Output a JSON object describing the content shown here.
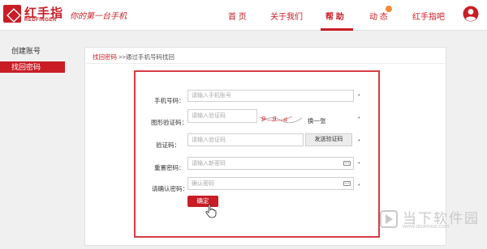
{
  "header": {
    "logo_cn": "红手指",
    "logo_en": "REDFINGER",
    "slogan": "你的第一台手机",
    "nav": [
      {
        "label": "首 页"
      },
      {
        "label": "关于我们"
      },
      {
        "label": "帮 助"
      },
      {
        "label": "动 态"
      },
      {
        "label": "红手指吧"
      }
    ],
    "active_nav": "帮 助"
  },
  "sidebar": {
    "items": [
      {
        "label": "创建账号"
      },
      {
        "label": "找回密码"
      }
    ],
    "active": "找回密码"
  },
  "breadcrumb": {
    "link": "找回密码",
    "rest": " >>通过手机号码找回"
  },
  "form": {
    "phone": {
      "label": "手机号码：",
      "placeholder": "请输入手机账号"
    },
    "captcha": {
      "label": "图形验证码：",
      "placeholder": "请输入验证码",
      "image_text": "9 9 a",
      "refresh": "换一张"
    },
    "sms_code": {
      "label": "验证码：",
      "placeholder": "请输入验证码",
      "send_button": "发送验证码"
    },
    "new_password": {
      "label": "重置密码：",
      "placeholder": "请输入新密码"
    },
    "confirm_password": {
      "label": "请确认密码：",
      "placeholder": "确认密码"
    },
    "required_mark": "*",
    "submit": "确定"
  },
  "watermark": {
    "cn": "当下软件园",
    "en": "www.downxia.com"
  },
  "colors": {
    "brand": "#c81d25",
    "form_border": "#d83b44",
    "background": "#f0f0f0"
  }
}
